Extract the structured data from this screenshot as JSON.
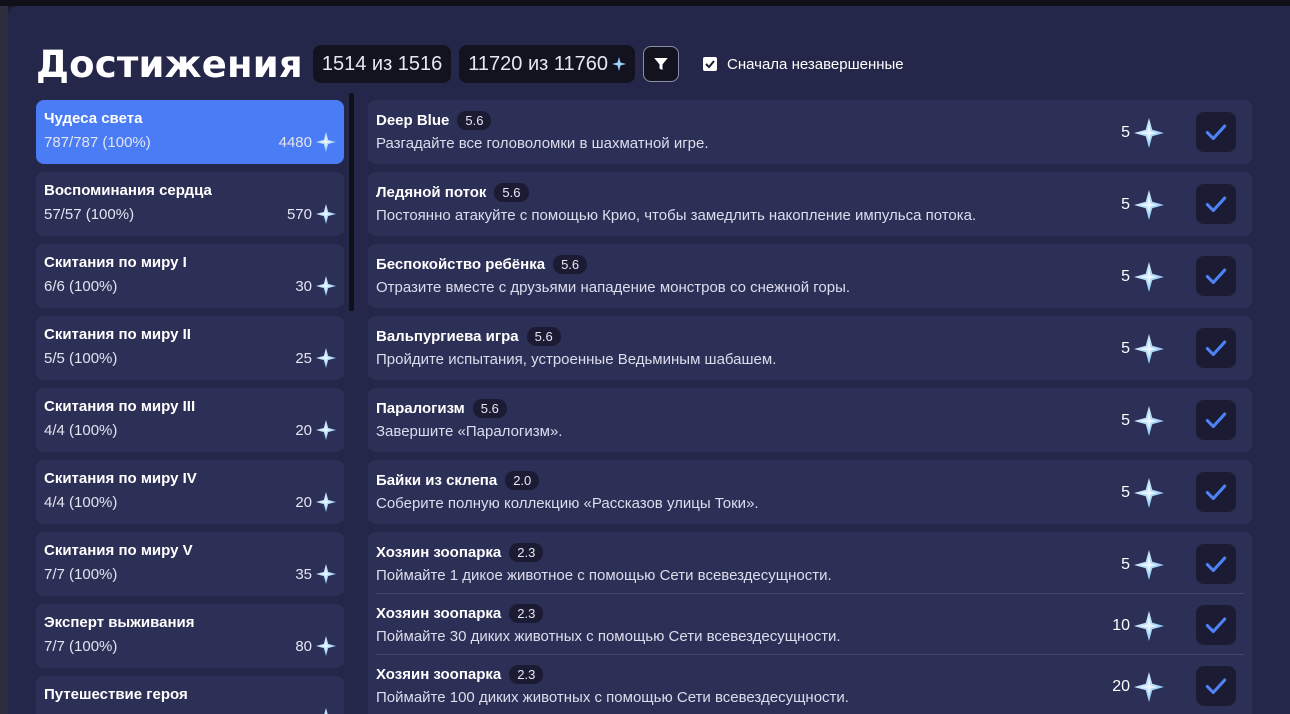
{
  "header": {
    "title": "Достижения",
    "achievements_count": "1514 из 1516",
    "primogems_count": "11720 из 11760",
    "incomplete_first_label": "Сначала незавершенные",
    "incomplete_first_checked": true
  },
  "categories": [
    {
      "name": "Чудеса света",
      "progress": "787/787 (100%)",
      "points": "4480",
      "active": true
    },
    {
      "name": "Воспоминания сердца",
      "progress": "57/57 (100%)",
      "points": "570"
    },
    {
      "name": "Скитания по миру I",
      "progress": "6/6 (100%)",
      "points": "30"
    },
    {
      "name": "Скитания по миру II",
      "progress": "5/5 (100%)",
      "points": "25"
    },
    {
      "name": "Скитания по миру III",
      "progress": "4/4 (100%)",
      "points": "20"
    },
    {
      "name": "Скитания по миру IV",
      "progress": "4/4 (100%)",
      "points": "20"
    },
    {
      "name": "Скитания по миру V",
      "progress": "7/7 (100%)",
      "points": "35"
    },
    {
      "name": "Эксперт выживания",
      "progress": "7/7 (100%)",
      "points": "80"
    },
    {
      "name": "Путешествие героя",
      "progress": "",
      "points": ""
    }
  ],
  "achievements": [
    {
      "name": "Deep Blue",
      "version": "5.6",
      "description": "Разгадайте все головоломки в шахматной игре.",
      "reward": "5"
    },
    {
      "name": "Ледяной поток",
      "version": "5.6",
      "description": "Постоянно атакуйте с помощью Крио, чтобы замедлить накопление импульса потока.",
      "reward": "5"
    },
    {
      "name": "Беспокойство ребёнка",
      "version": "5.6",
      "description": "Отразите вместе с друзьями нападение монстров со снежной горы.",
      "reward": "5"
    },
    {
      "name": "Вальпургиева игра",
      "version": "5.6",
      "description": "Пройдите испытания, устроенные Ведьминым шабашем.",
      "reward": "5"
    },
    {
      "name": "Паралогизм",
      "version": "5.6",
      "description": "Завершите «Паралогизм».",
      "reward": "5"
    },
    {
      "name": "Байки из склепа",
      "version": "2.0",
      "description": "Соберите полную коллекцию «Рассказов улицы Токи».",
      "reward": "5"
    }
  ],
  "achievement_group": [
    {
      "name": "Хозяин зоопарка",
      "version": "2.3",
      "description": "Поймайте 1 дикое животное с помощью Сети всевездесущности.",
      "reward": "5"
    },
    {
      "name": "Хозяин зоопарка",
      "version": "2.3",
      "description": "Поймайте 30 диких животных с помощью Сети всевездесущности.",
      "reward": "10"
    },
    {
      "name": "Хозяин зоопарка",
      "version": "2.3",
      "description": "Поймайте 100 диких животных с помощью Сети всевездесущности.",
      "reward": "20"
    }
  ],
  "icons": {
    "reward": "primogem-icon",
    "completed": "checkmark-icon",
    "filter": "filter-icon"
  },
  "colors": {
    "accent": "#4a7cf5",
    "check": "#4f82f7"
  }
}
